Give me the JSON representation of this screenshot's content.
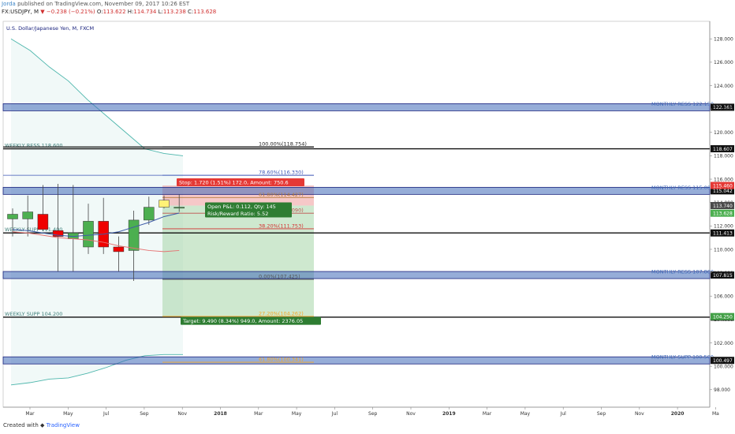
{
  "header": {
    "author": "Jorda",
    "published": " published on TradingView.com, November 09, 2017 10:26 EST",
    "symbol_line": "FX:USDJPY, M",
    "open_prefix": "O:",
    "open": "113.622",
    "high_prefix": "H:",
    "high": "114.734",
    "low_prefix": "L:",
    "low": "113.238",
    "close_prefix": "C:",
    "close": "113.628",
    "last": "113.628",
    "change": "▼ −0.238 (−0.21%)"
  },
  "footer": {
    "created_with": "Created with",
    "brand": "TradingView"
  },
  "colors": {
    "bull": "#4caf50",
    "bear": "#f00000",
    "yellow_candle": "#fff176",
    "zone_blue": "#3f6ab8",
    "stop_red": "#ef9a9a",
    "target_green": "#a5d6a7",
    "cloud_teal": "#4db6ac"
  },
  "chart_data": {
    "type": "candlestick",
    "title": "U.S. Dollar/Japanese Yen, M, FXCM",
    "ylim": [
      96.5,
      129.5
    ],
    "y_ticks": [
      98.0,
      100.0,
      102.0,
      104.0,
      106.0,
      108.0,
      110.0,
      112.0,
      114.0,
      116.0,
      118.0,
      120.0,
      122.0,
      124.0,
      126.0,
      128.0
    ],
    "x_ticks": [
      "Mar",
      "May",
      "Jul",
      "Sep",
      "Nov",
      "2018",
      "Mar",
      "May",
      "Jul",
      "Sep",
      "Nov",
      "2019",
      "Mar",
      "May",
      "Jul",
      "Sep",
      "Nov",
      "2020",
      "Ma"
    ],
    "ohlc": [
      {
        "o": 112.6,
        "h": 113.5,
        "l": 111.1,
        "c": 113.0
      },
      {
        "o": 112.6,
        "h": 114.6,
        "l": 111.1,
        "c": 113.2
      },
      {
        "o": 113.0,
        "h": 115.5,
        "l": 111.6,
        "c": 111.7
      },
      {
        "o": 111.6,
        "h": 115.6,
        "l": 108.1,
        "c": 111.1
      },
      {
        "o": 110.9,
        "h": 115.5,
        "l": 108.1,
        "c": 111.4
      },
      {
        "o": 110.2,
        "h": 113.9,
        "l": 109.6,
        "c": 112.4
      },
      {
        "o": 112.4,
        "h": 114.4,
        "l": 109.6,
        "c": 110.2
      },
      {
        "o": 110.2,
        "h": 111.1,
        "l": 108.1,
        "c": 109.8
      },
      {
        "o": 109.9,
        "h": 113.3,
        "l": 107.3,
        "c": 112.5
      },
      {
        "o": 112.5,
        "h": 114.5,
        "l": 112.1,
        "c": 113.6
      },
      {
        "o": 113.6,
        "h": 114.6,
        "l": 113.5,
        "c": 114.2
      },
      {
        "o": 113.6,
        "h": 114.7,
        "l": 113.2,
        "c": 113.6
      }
    ],
    "moving_averages": [
      {
        "color": "#e57373",
        "values": [
          111.5,
          111.4,
          111.2,
          111.0,
          110.9,
          110.8,
          110.6,
          110.3,
          110.1,
          109.9,
          109.8,
          109.9
        ]
      },
      {
        "color": "#3e5ba8",
        "values": [
          111.7,
          111.6,
          111.4,
          111.2,
          111.1,
          111.2,
          111.3,
          111.5,
          111.9,
          112.3,
          112.8,
          113.1
        ]
      }
    ],
    "levels": [
      {
        "label": "MONTHLY RESS 122.150",
        "value": 122.15,
        "axis": "122.161",
        "kind": "zone"
      },
      {
        "label": "WEEKLY RESS 118.600",
        "value": 118.6,
        "axis": "118.607",
        "kind": "line"
      },
      {
        "label": "MONTHLY RESS 115.000",
        "value": 115.0,
        "axis": "115.042",
        "kind": "zone"
      },
      {
        "label": "WEEKLY SUPP 111.400",
        "value": 111.4,
        "axis": "111.413",
        "kind": "line"
      },
      {
        "label": "MONTHLY RESS 107.800",
        "value": 107.8,
        "axis": "107.815",
        "kind": "zone"
      },
      {
        "label": "WEEKLY SUPP 104.200",
        "value": 104.2,
        "axis": "104.218",
        "kind": "line"
      },
      {
        "label": "MONTHLY SUPP 100.500",
        "value": 100.5,
        "axis": "100.497",
        "kind": "zone"
      }
    ],
    "fibonacci": [
      {
        "label": "100.00%(118.754)",
        "value": 118.754,
        "color": "#222"
      },
      {
        "label": "78.60%(116.330)",
        "value": 116.33,
        "color": "#3a54b5"
      },
      {
        "label": "61.80%(114.427)",
        "value": 114.427,
        "color": "#b57a3a"
      },
      {
        "label": "50.00%(113.090)",
        "value": 113.09,
        "color": "#c0504d"
      },
      {
        "label": "38.20%(111.753)",
        "value": 111.753,
        "color": "#d32f2f"
      },
      {
        "label": "0.00%(107.425)",
        "value": 107.425,
        "color": "#555"
      },
      {
        "label": "27.20%(104.262)",
        "value": 104.262,
        "color": "#f5a623"
      },
      {
        "label": "61.80%(100.341)",
        "value": 100.341,
        "color": "#f5a623"
      }
    ],
    "position": {
      "entry": 113.74,
      "stop": 115.46,
      "target": 104.25,
      "stop_label": "Stop: 1.720 (1.51%) 172.0, Amount: 750.6",
      "pnl_label": "Open P&L: 0.112, Qty: 145",
      "rr_label": "Risk/Reward Ratio: 5.52",
      "target_label": "Target: 9.490 (8.34%) 949.0, Amount: 2376.05",
      "axis_stop": "115.460",
      "axis_entry": "113.740",
      "axis_target": "104.250"
    },
    "cloud_upper": [
      128.0,
      127.0,
      125.6,
      124.4,
      122.8,
      121.4,
      120.0,
      118.6,
      118.2,
      118.0
    ],
    "cloud_lower": [
      98.4,
      98.6,
      98.9,
      99.0,
      99.4,
      99.9,
      100.5,
      100.9,
      101.0,
      101.0
    ]
  }
}
